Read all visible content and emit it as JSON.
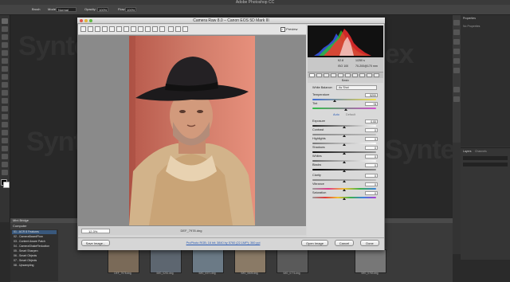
{
  "app": {
    "title": "Adobe Photoshop CC",
    "watermark": "Syntex"
  },
  "options_bar": {
    "brush": "Brush",
    "mode_label": "Mode:",
    "mode_value": "Normal",
    "opacity_label": "Opacity:",
    "opacity_value": "100%",
    "flow_label": "Flow:",
    "flow_value": "100%"
  },
  "right_panel": {
    "properties_tab": "Properties",
    "no_properties": "No Properties",
    "layers_tab": "Layers",
    "channels_tab": "Channels"
  },
  "camera_raw": {
    "title": "Camera Raw 8.0  –  Canon EOS 5D Mark III",
    "preview_label": "Preview",
    "preview_checked": true,
    "zoom_value": "12.3%",
    "file_name": "DEF_7978.dng",
    "rgb_readout": {
      "fstop": "f/2.8",
      "shutter": "1/250 s",
      "iso": "ISO 100",
      "lens": "70-200@170 mm"
    },
    "panel_title": "Basic",
    "white_balance_label": "White Balance:",
    "white_balance_value": "As Shot",
    "rows": [
      {
        "label": "Temperature",
        "value": "5200"
      },
      {
        "label": "Tint",
        "value": "+8"
      }
    ],
    "auto_label": "Auto",
    "default_label": "Default",
    "tone_rows": [
      {
        "label": "Exposure",
        "value": "0.00"
      },
      {
        "label": "Contrast",
        "value": "0"
      },
      {
        "label": "Highlights",
        "value": "0"
      },
      {
        "label": "Shadows",
        "value": "0"
      },
      {
        "label": "Whites",
        "value": "0"
      },
      {
        "label": "Blacks",
        "value": "0"
      }
    ],
    "presence_rows": [
      {
        "label": "Clarity",
        "value": "0"
      },
      {
        "label": "Vibrance",
        "value": "0"
      },
      {
        "label": "Saturation",
        "value": "0"
      }
    ],
    "save_button": "Save Image...",
    "workflow_link": "ProPhoto RGB; 16 bit; 3840 by 5760 (22.1MP); 360 ppi",
    "open_button": "Open Image",
    "cancel_button": "Cancel",
    "done_button": "Done"
  },
  "mini_bridge": {
    "title": "Mini Bridge",
    "path_label": "Computer",
    "sidebar": [
      "01 - ACR 8 Features",
      "02 - CameraBasedFlow",
      "03 - Content Aware Patch",
      "04 - CameraShakeReduction",
      "05 - Smart Sharpen",
      "06 - Smart Objects",
      "07 - Smart Objects",
      "08 - Upsampling"
    ],
    "thumbnails": [
      "DEF_7978.dng",
      "IMG_0251.dng",
      "IMG_0371.dng",
      "IMG_0605.dng",
      "IMG_0776.dng",
      "IMG_0783.dng"
    ]
  }
}
